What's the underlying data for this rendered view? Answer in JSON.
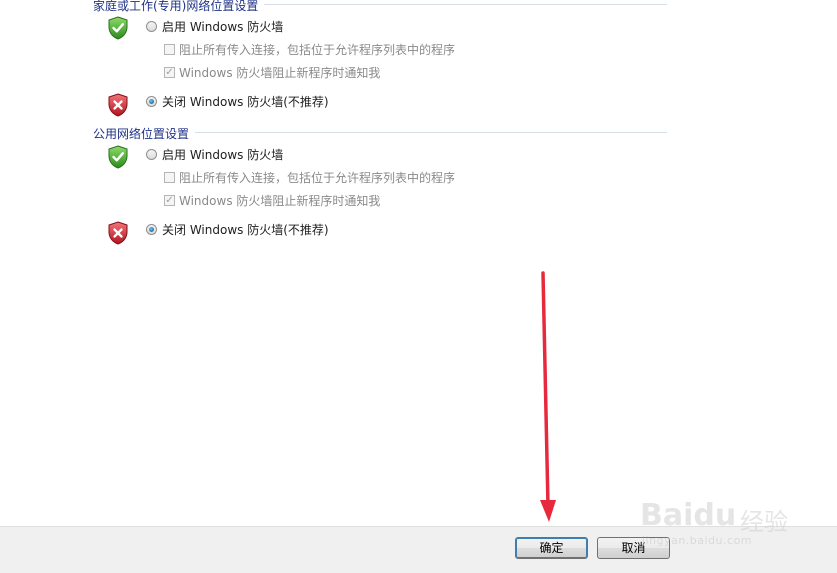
{
  "sections": [
    {
      "title": "家庭或工作(专用)网络位置设置",
      "enable_label": "启用 Windows 防火墙",
      "block_all_label": "阻止所有传入连接，包括位于允许程序列表中的程序",
      "notify_label": "Windows 防火墙阻止新程序时通知我",
      "disable_label": "关闭 Windows 防火墙(不推荐)",
      "selected": "disable",
      "block_all_checked": false,
      "notify_checked": true
    },
    {
      "title": "公用网络位置设置",
      "enable_label": "启用 Windows 防火墙",
      "block_all_label": "阻止所有传入连接，包括位于允许程序列表中的程序",
      "notify_label": "Windows 防火墙阻止新程序时通知我",
      "disable_label": "关闭 Windows 防火墙(不推荐)",
      "selected": "disable",
      "block_all_checked": false,
      "notify_checked": true
    }
  ],
  "footer": {
    "ok_label": "确定",
    "cancel_label": "取消"
  },
  "watermark": {
    "brand": "Baidu",
    "brand_cn": "经验",
    "url": "jingyan.baidu.com"
  },
  "colors": {
    "section_title": "#1e3287",
    "annotation_arrow": "#e8283c",
    "shield_green": "#3a9a2a",
    "shield_red": "#c8232c"
  }
}
